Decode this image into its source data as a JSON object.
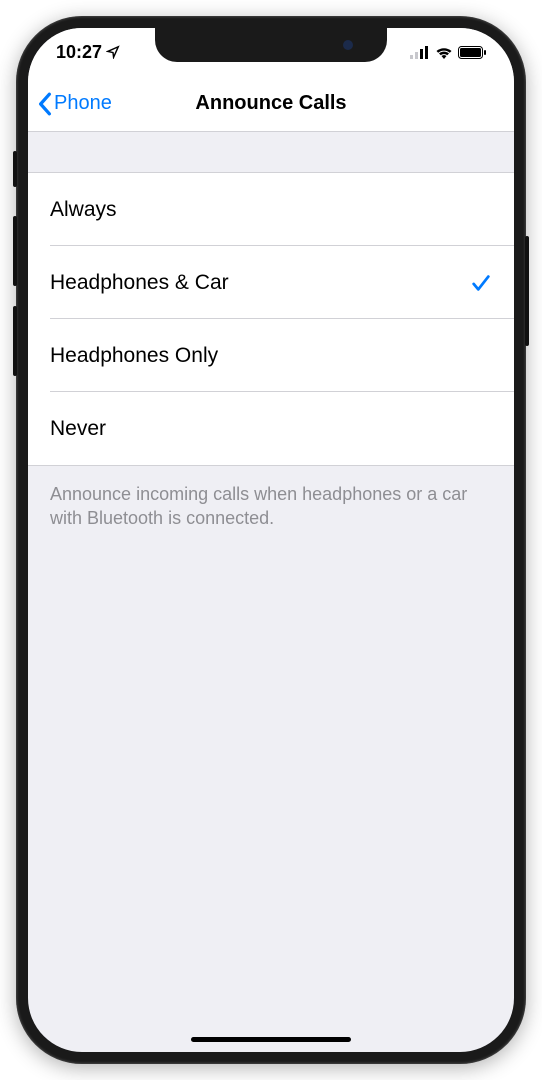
{
  "status": {
    "time": "10:27"
  },
  "nav": {
    "back_label": "Phone",
    "title": "Announce Calls"
  },
  "options": [
    {
      "label": "Always",
      "selected": false
    },
    {
      "label": "Headphones & Car",
      "selected": true
    },
    {
      "label": "Headphones Only",
      "selected": false
    },
    {
      "label": "Never",
      "selected": false
    }
  ],
  "footer": "Announce incoming calls when headphones or a car with Bluetooth is connected."
}
